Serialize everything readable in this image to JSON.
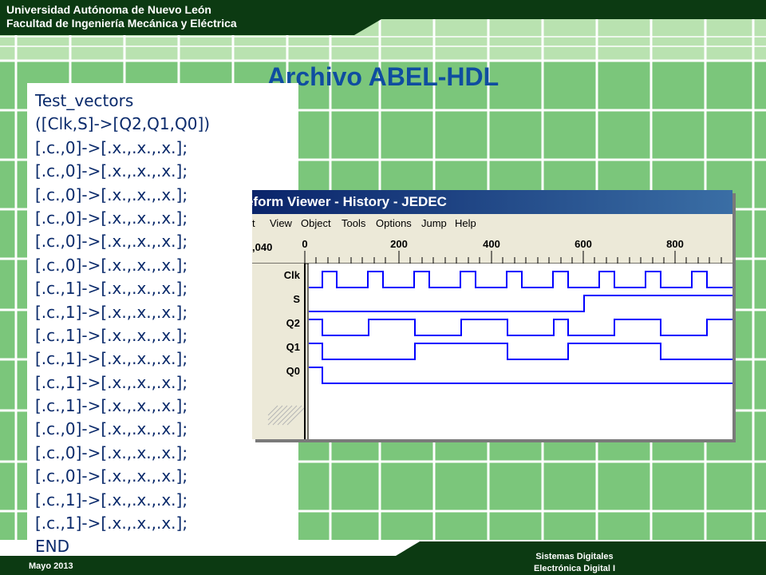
{
  "header": {
    "line1": "Universidad Autónoma de Nuevo León",
    "line2": "Facultad de Ingeniería Mecánica y Eléctrica"
  },
  "slide_title": "Archivo ABEL-HDL",
  "code": {
    "lines": [
      "Test_vectors",
      "([Clk,S]->[Q2,Q1,Q0])",
      "[.c.,0]->[.x.,.x.,.x.];",
      "[.c.,0]->[.x.,.x.,.x.];",
      "[.c.,0]->[.x.,.x.,.x.];",
      "[.c.,0]->[.x.,.x.,.x.];",
      "[.c.,0]->[.x.,.x.,.x.];",
      "[.c.,0]->[.x.,.x.,.x.];",
      "[.c.,1]->[.x.,.x.,.x.];",
      "[.c.,1]->[.x.,.x.,.x.];",
      "[.c.,1]->[.x.,.x.,.x.];",
      "[.c.,1]->[.x.,.x.,.x.];",
      "[.c.,1]->[.x.,.x.,.x.];",
      "[.c.,1]->[.x.,.x.,.x.];",
      "[.c.,0]->[.x.,.x.,.x.];",
      "[.c.,0]->[.x.,.x.,.x.];",
      "[.c.,0]->[.x.,.x.,.x.];",
      "[.c.,1]->[.x.,.x.,.x.];",
      "[.c.,1]->[.x.,.x.,.x.];",
      "END"
    ]
  },
  "waveform_viewer": {
    "window_title": "eform Viewer - History - JEDEC",
    "menu": [
      "t",
      "View",
      "Object",
      "Tools",
      "Options",
      "Jump",
      "Help"
    ],
    "cursor_time": ",040",
    "time_axis": [
      "0",
      "200",
      "400",
      "600",
      "800"
    ],
    "signals": [
      "Clk",
      "S",
      "Q2",
      "Q1",
      "Q0"
    ]
  },
  "footer": {
    "date": "Mayo 2013",
    "course1": "Sistemas Digitales",
    "course2": "Electrónica Digital I"
  },
  "colors": {
    "header_green": "#0c3a12",
    "grid_green": "#7bc67b",
    "title_blue": "#0f4da0",
    "code_text": "#0a2a6b",
    "wave_blue": "#0000ff"
  }
}
